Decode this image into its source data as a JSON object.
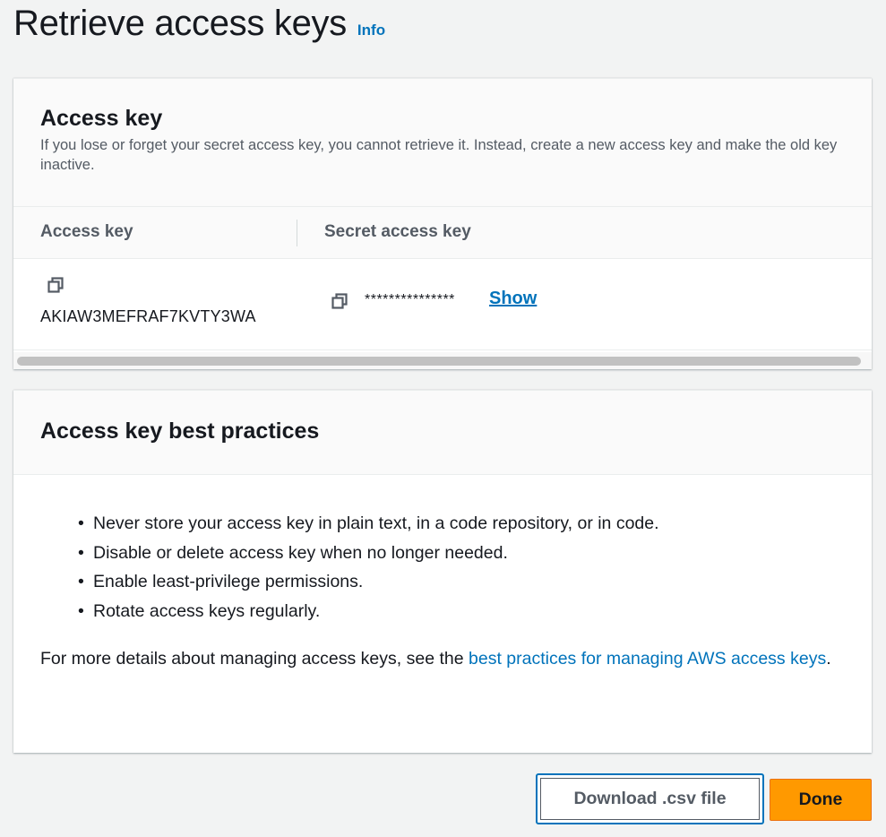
{
  "header": {
    "title": "Retrieve access keys",
    "info_label": "Info"
  },
  "access_key_card": {
    "title": "Access key",
    "description": "If you lose or forget your secret access key, you cannot retrieve it. Instead, create a new access key and make the old key inactive.",
    "columns": [
      "Access key",
      "Secret access key"
    ],
    "row": {
      "access_key_id": "AKIAW3MEFRAF7KVTY3WA",
      "secret_masked": "***************",
      "show_label": "Show"
    },
    "icons": [
      "copy-icon",
      "copy-icon"
    ]
  },
  "best_practices_card": {
    "title": "Access key best practices",
    "items": [
      "Never store your access key in plain text, in a code repository, or in code.",
      "Disable or delete access key when no longer needed.",
      "Enable least-privilege permissions.",
      "Rotate access keys regularly."
    ],
    "more_prefix": "For more details about managing access keys, see the ",
    "more_link": "best practices for managing AWS access keys",
    "more_suffix": "."
  },
  "footer": {
    "download_label": "Download .csv file",
    "done_label": "Done"
  },
  "colors": {
    "link": "#0073bb",
    "primary_button": "#ff9900",
    "background": "#f2f3f3"
  }
}
